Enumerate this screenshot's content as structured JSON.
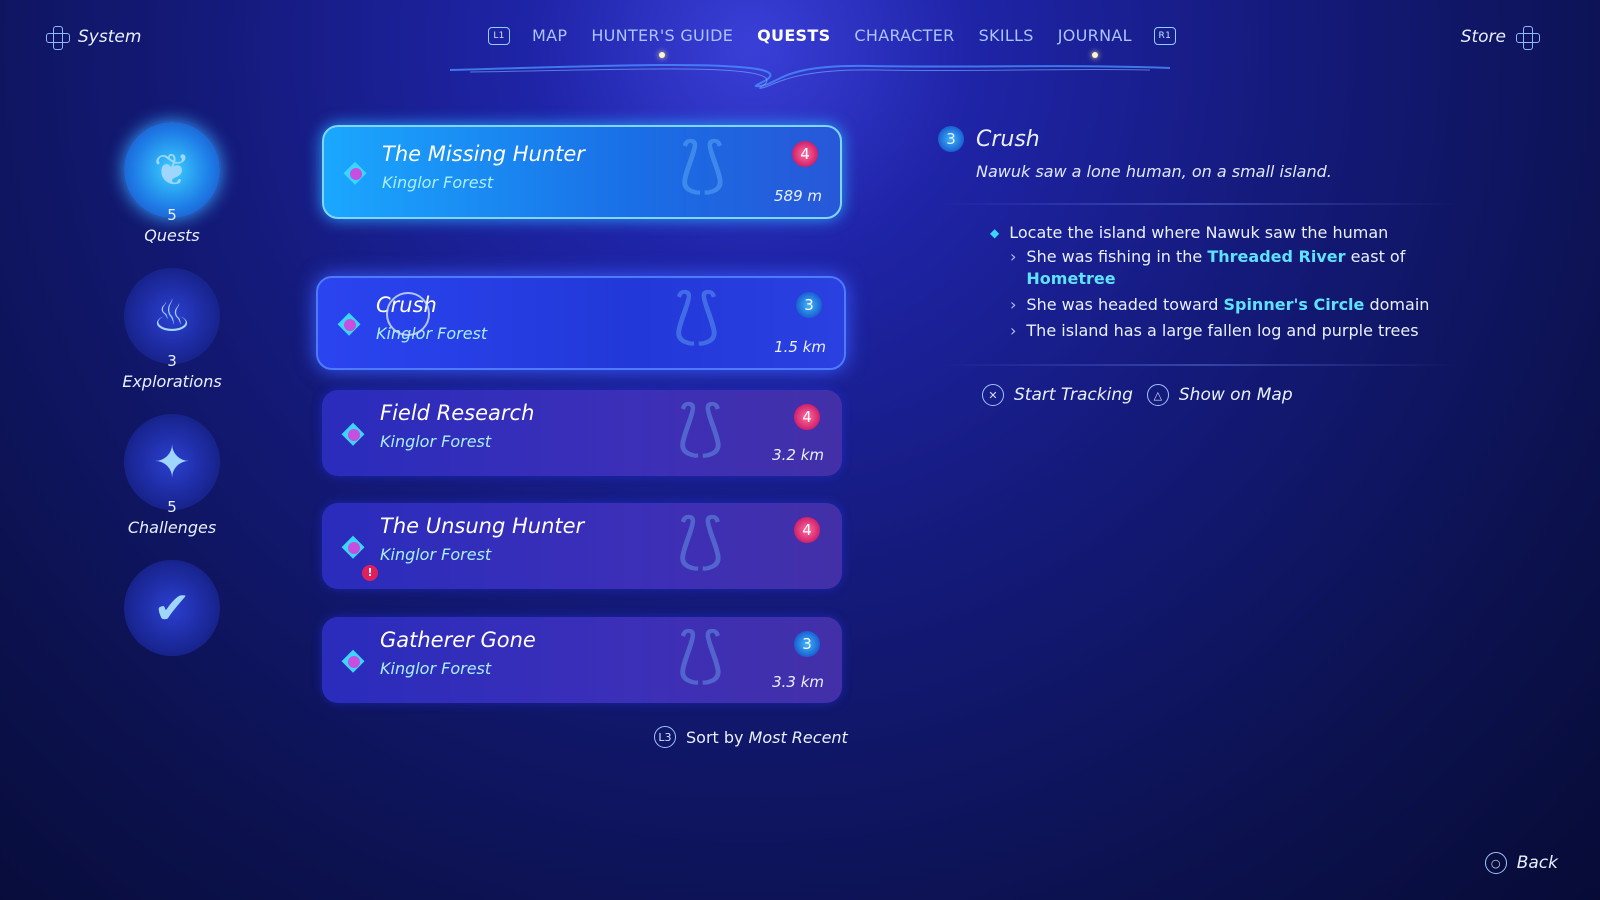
{
  "header": {
    "system_label": "System",
    "store_label": "Store",
    "left_bumper": "L1",
    "right_bumper": "R1",
    "tabs": [
      {
        "label": "MAP",
        "active": false,
        "notify": false
      },
      {
        "label": "HUNTER'S GUIDE",
        "active": false,
        "notify": true
      },
      {
        "label": "QUESTS",
        "active": true,
        "notify": false
      },
      {
        "label": "CHARACTER",
        "active": false,
        "notify": false
      },
      {
        "label": "SKILLS",
        "active": false,
        "notify": false
      },
      {
        "label": "JOURNAL",
        "active": false,
        "notify": true
      }
    ]
  },
  "sidebar": {
    "categories": [
      {
        "label": "Quests",
        "count": "5",
        "icon": "quest-feather-icon",
        "active": true
      },
      {
        "label": "Explorations",
        "count": "3",
        "icon": "exploration-flame-icon",
        "active": false
      },
      {
        "label": "Challenges",
        "count": "5",
        "icon": "challenge-arrows-icon",
        "active": false
      },
      {
        "label": "",
        "count": "",
        "icon": "completed-check-icon",
        "active": false
      }
    ]
  },
  "quests": [
    {
      "title": "The Missing Hunter",
      "location": "Kinglor Forest",
      "level": "4",
      "level_color": "red",
      "distance": "589 m",
      "state": "tracked",
      "alert": false
    },
    {
      "title": "Crush",
      "location": "Kinglor Forest",
      "level": "3",
      "level_color": "blue",
      "distance": "1.5 km",
      "state": "selected",
      "alert": false
    },
    {
      "title": "Field Research",
      "location": "Kinglor Forest",
      "level": "4",
      "level_color": "red",
      "distance": "3.2 km",
      "state": "normal",
      "alert": false
    },
    {
      "title": "The Unsung Hunter",
      "location": "Kinglor Forest",
      "level": "4",
      "level_color": "red",
      "distance": "",
      "state": "normal",
      "alert": true
    },
    {
      "title": "Gatherer Gone",
      "location": "Kinglor Forest",
      "level": "3",
      "level_color": "blue",
      "distance": "3.3 km",
      "state": "normal",
      "alert": false
    }
  ],
  "sort": {
    "button": "L3",
    "prefix": "Sort by",
    "value": "Most Recent"
  },
  "detail": {
    "level": "3",
    "title": "Crush",
    "description": "Nawuk saw a lone human, on a small island.",
    "objective": "Locate the island where Nawuk saw the human",
    "hints": [
      {
        "parts": [
          {
            "t": "She was fishing in the ",
            "hl": false
          },
          {
            "t": "Threaded River",
            "hl": true
          },
          {
            "t": " east of ",
            "hl": false
          },
          {
            "t": "Hometree",
            "hl": true
          }
        ]
      },
      {
        "parts": [
          {
            "t": "She was headed toward ",
            "hl": false
          },
          {
            "t": "Spinner's Circle",
            "hl": true
          },
          {
            "t": " domain",
            "hl": false
          }
        ]
      },
      {
        "parts": [
          {
            "t": "The island has a large fallen log and purple trees",
            "hl": false
          }
        ]
      }
    ],
    "actions": [
      {
        "glyph": "✕",
        "label": "Start Tracking"
      },
      {
        "glyph": "△",
        "label": "Show on Map"
      }
    ]
  },
  "footer": {
    "back_glyph": "○",
    "back_label": "Back"
  },
  "colors": {
    "accent": "#5ee2ff",
    "level_red": "#d0206a",
    "level_blue": "#1a60d0"
  }
}
